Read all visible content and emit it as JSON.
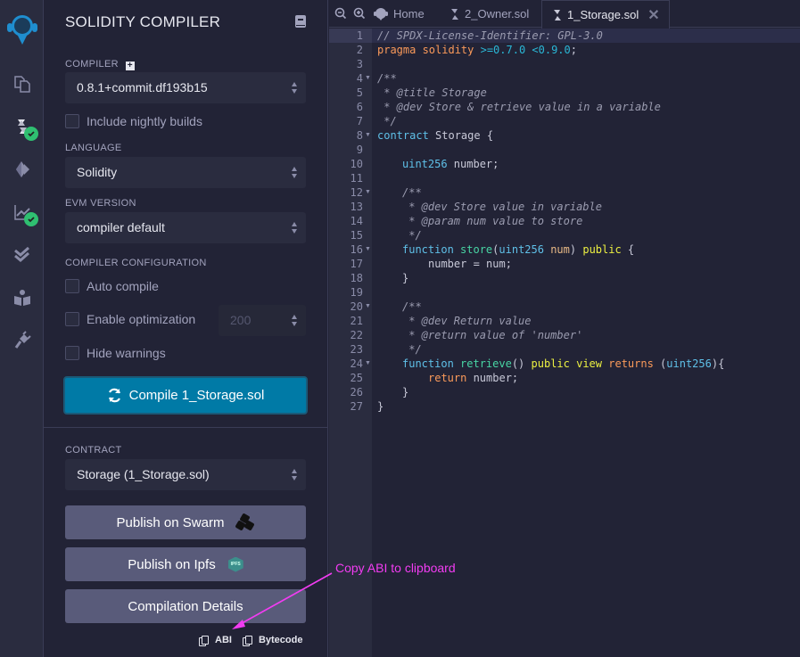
{
  "panel": {
    "title": "SOLIDITY COMPILER",
    "compiler_label": "COMPILER",
    "compiler_value": "0.8.1+commit.df193b15",
    "include_nightly": "Include nightly builds",
    "language_label": "LANGUAGE",
    "language_value": "Solidity",
    "evm_label": "EVM VERSION",
    "evm_value": "compiler default",
    "config_label": "COMPILER CONFIGURATION",
    "auto_compile": "Auto compile",
    "enable_optimization": "Enable optimization",
    "optimization_runs": "200",
    "hide_warnings": "Hide warnings",
    "compile_button": "Compile 1_Storage.sol",
    "contract_label": "CONTRACT",
    "contract_value": "Storage (1_Storage.sol)",
    "publish_swarm": "Publish on Swarm",
    "publish_ipfs": "Publish on Ipfs",
    "ipfs_badge": "IPFS",
    "compilation_details": "Compilation Details",
    "abi": "ABI",
    "bytecode": "Bytecode"
  },
  "tabs": {
    "home": "Home",
    "owner": "2_Owner.sol",
    "storage": "1_Storage.sol"
  },
  "annotation": "Copy ABI to clipboard",
  "colors": {
    "accent": "#007aa6",
    "check": "#2fbf71",
    "annotation": "#f23cf2"
  },
  "code": {
    "line_numbers": [
      "1",
      "2",
      "3",
      "4",
      "5",
      "6",
      "7",
      "8",
      "9",
      "10",
      "11",
      "12",
      "13",
      "14",
      "15",
      "16",
      "17",
      "18",
      "19",
      "20",
      "21",
      "22",
      "23",
      "24",
      "25",
      "26",
      "27"
    ],
    "l1": "// SPDX-License-Identifier: GPL-3.0",
    "l2_kw": "pragma solidity",
    "l2_ver": ">=0.7.0 <0.9.0",
    "l2_end": ";",
    "l4": "/**",
    "l5": " * @title Storage",
    "l6": " * @dev Store & retrieve value in a variable",
    "l7": " */",
    "l8_kw": "contract",
    "l8_rest": " Storage {",
    "l10_type": "uint256",
    "l10_rest": " number;",
    "l12": "/**",
    "l13": " * @dev Store value in variable",
    "l14": " * @param num value to store",
    "l15": " */",
    "l16_kw": "function",
    "l16_fn": "store",
    "l16_p1": "(",
    "l16_type": "uint256",
    "l16_param": "num",
    "l16_p2": ") ",
    "l16_pub": "public",
    "l16_end": " {",
    "l17": "number = num;",
    "l18": "}",
    "l20": "/**",
    "l21": " * @dev Return value",
    "l22": " * @return value of 'number'",
    "l23": " */",
    "l24_kw": "function",
    "l24_fn": "retrieve",
    "l24_p": "() ",
    "l24_pub": "public",
    "l24_view": "view",
    "l24_ret": "returns",
    "l24_p3": " (",
    "l24_type": "uint256",
    "l24_end": "){",
    "l25_kw": "return",
    "l25_rest": " number;",
    "l26": "}",
    "l27": "}"
  }
}
